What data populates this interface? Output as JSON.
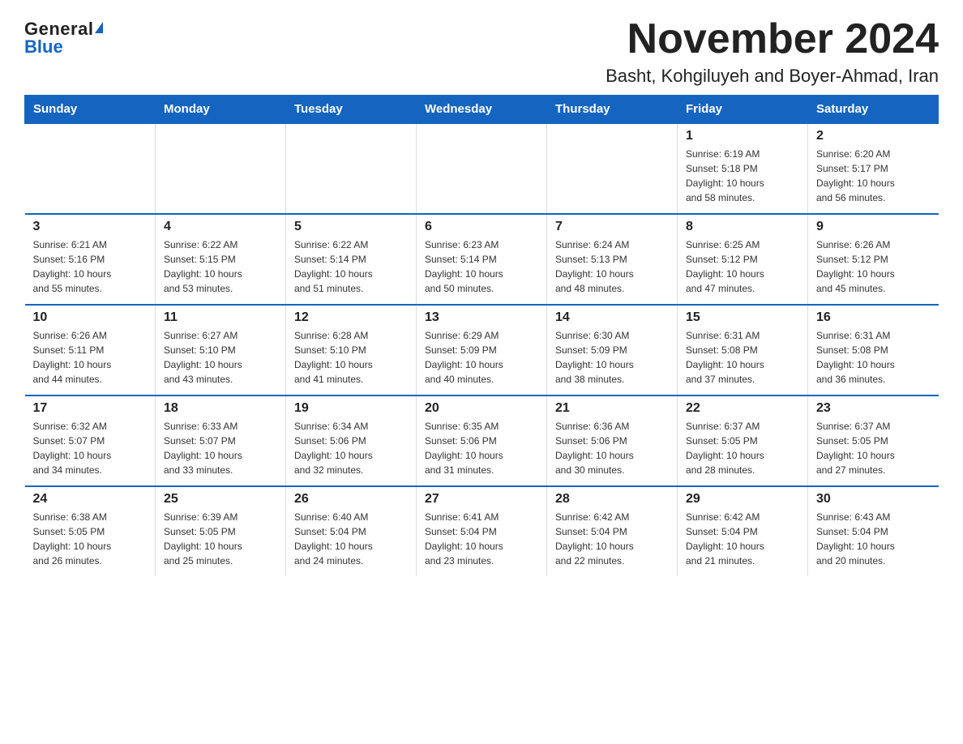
{
  "logo": {
    "general": "General",
    "blue": "Blue"
  },
  "title": "November 2024",
  "subtitle": "Basht, Kohgiluyeh and Boyer-Ahmad, Iran",
  "weekdays": [
    "Sunday",
    "Monday",
    "Tuesday",
    "Wednesday",
    "Thursday",
    "Friday",
    "Saturday"
  ],
  "weeks": [
    [
      {
        "day": "",
        "info": ""
      },
      {
        "day": "",
        "info": ""
      },
      {
        "day": "",
        "info": ""
      },
      {
        "day": "",
        "info": ""
      },
      {
        "day": "",
        "info": ""
      },
      {
        "day": "1",
        "info": "Sunrise: 6:19 AM\nSunset: 5:18 PM\nDaylight: 10 hours\nand 58 minutes."
      },
      {
        "day": "2",
        "info": "Sunrise: 6:20 AM\nSunset: 5:17 PM\nDaylight: 10 hours\nand 56 minutes."
      }
    ],
    [
      {
        "day": "3",
        "info": "Sunrise: 6:21 AM\nSunset: 5:16 PM\nDaylight: 10 hours\nand 55 minutes."
      },
      {
        "day": "4",
        "info": "Sunrise: 6:22 AM\nSunset: 5:15 PM\nDaylight: 10 hours\nand 53 minutes."
      },
      {
        "day": "5",
        "info": "Sunrise: 6:22 AM\nSunset: 5:14 PM\nDaylight: 10 hours\nand 51 minutes."
      },
      {
        "day": "6",
        "info": "Sunrise: 6:23 AM\nSunset: 5:14 PM\nDaylight: 10 hours\nand 50 minutes."
      },
      {
        "day": "7",
        "info": "Sunrise: 6:24 AM\nSunset: 5:13 PM\nDaylight: 10 hours\nand 48 minutes."
      },
      {
        "day": "8",
        "info": "Sunrise: 6:25 AM\nSunset: 5:12 PM\nDaylight: 10 hours\nand 47 minutes."
      },
      {
        "day": "9",
        "info": "Sunrise: 6:26 AM\nSunset: 5:12 PM\nDaylight: 10 hours\nand 45 minutes."
      }
    ],
    [
      {
        "day": "10",
        "info": "Sunrise: 6:26 AM\nSunset: 5:11 PM\nDaylight: 10 hours\nand 44 minutes."
      },
      {
        "day": "11",
        "info": "Sunrise: 6:27 AM\nSunset: 5:10 PM\nDaylight: 10 hours\nand 43 minutes."
      },
      {
        "day": "12",
        "info": "Sunrise: 6:28 AM\nSunset: 5:10 PM\nDaylight: 10 hours\nand 41 minutes."
      },
      {
        "day": "13",
        "info": "Sunrise: 6:29 AM\nSunset: 5:09 PM\nDaylight: 10 hours\nand 40 minutes."
      },
      {
        "day": "14",
        "info": "Sunrise: 6:30 AM\nSunset: 5:09 PM\nDaylight: 10 hours\nand 38 minutes."
      },
      {
        "day": "15",
        "info": "Sunrise: 6:31 AM\nSunset: 5:08 PM\nDaylight: 10 hours\nand 37 minutes."
      },
      {
        "day": "16",
        "info": "Sunrise: 6:31 AM\nSunset: 5:08 PM\nDaylight: 10 hours\nand 36 minutes."
      }
    ],
    [
      {
        "day": "17",
        "info": "Sunrise: 6:32 AM\nSunset: 5:07 PM\nDaylight: 10 hours\nand 34 minutes."
      },
      {
        "day": "18",
        "info": "Sunrise: 6:33 AM\nSunset: 5:07 PM\nDaylight: 10 hours\nand 33 minutes."
      },
      {
        "day": "19",
        "info": "Sunrise: 6:34 AM\nSunset: 5:06 PM\nDaylight: 10 hours\nand 32 minutes."
      },
      {
        "day": "20",
        "info": "Sunrise: 6:35 AM\nSunset: 5:06 PM\nDaylight: 10 hours\nand 31 minutes."
      },
      {
        "day": "21",
        "info": "Sunrise: 6:36 AM\nSunset: 5:06 PM\nDaylight: 10 hours\nand 30 minutes."
      },
      {
        "day": "22",
        "info": "Sunrise: 6:37 AM\nSunset: 5:05 PM\nDaylight: 10 hours\nand 28 minutes."
      },
      {
        "day": "23",
        "info": "Sunrise: 6:37 AM\nSunset: 5:05 PM\nDaylight: 10 hours\nand 27 minutes."
      }
    ],
    [
      {
        "day": "24",
        "info": "Sunrise: 6:38 AM\nSunset: 5:05 PM\nDaylight: 10 hours\nand 26 minutes."
      },
      {
        "day": "25",
        "info": "Sunrise: 6:39 AM\nSunset: 5:05 PM\nDaylight: 10 hours\nand 25 minutes."
      },
      {
        "day": "26",
        "info": "Sunrise: 6:40 AM\nSunset: 5:04 PM\nDaylight: 10 hours\nand 24 minutes."
      },
      {
        "day": "27",
        "info": "Sunrise: 6:41 AM\nSunset: 5:04 PM\nDaylight: 10 hours\nand 23 minutes."
      },
      {
        "day": "28",
        "info": "Sunrise: 6:42 AM\nSunset: 5:04 PM\nDaylight: 10 hours\nand 22 minutes."
      },
      {
        "day": "29",
        "info": "Sunrise: 6:42 AM\nSunset: 5:04 PM\nDaylight: 10 hours\nand 21 minutes."
      },
      {
        "day": "30",
        "info": "Sunrise: 6:43 AM\nSunset: 5:04 PM\nDaylight: 10 hours\nand 20 minutes."
      }
    ]
  ]
}
